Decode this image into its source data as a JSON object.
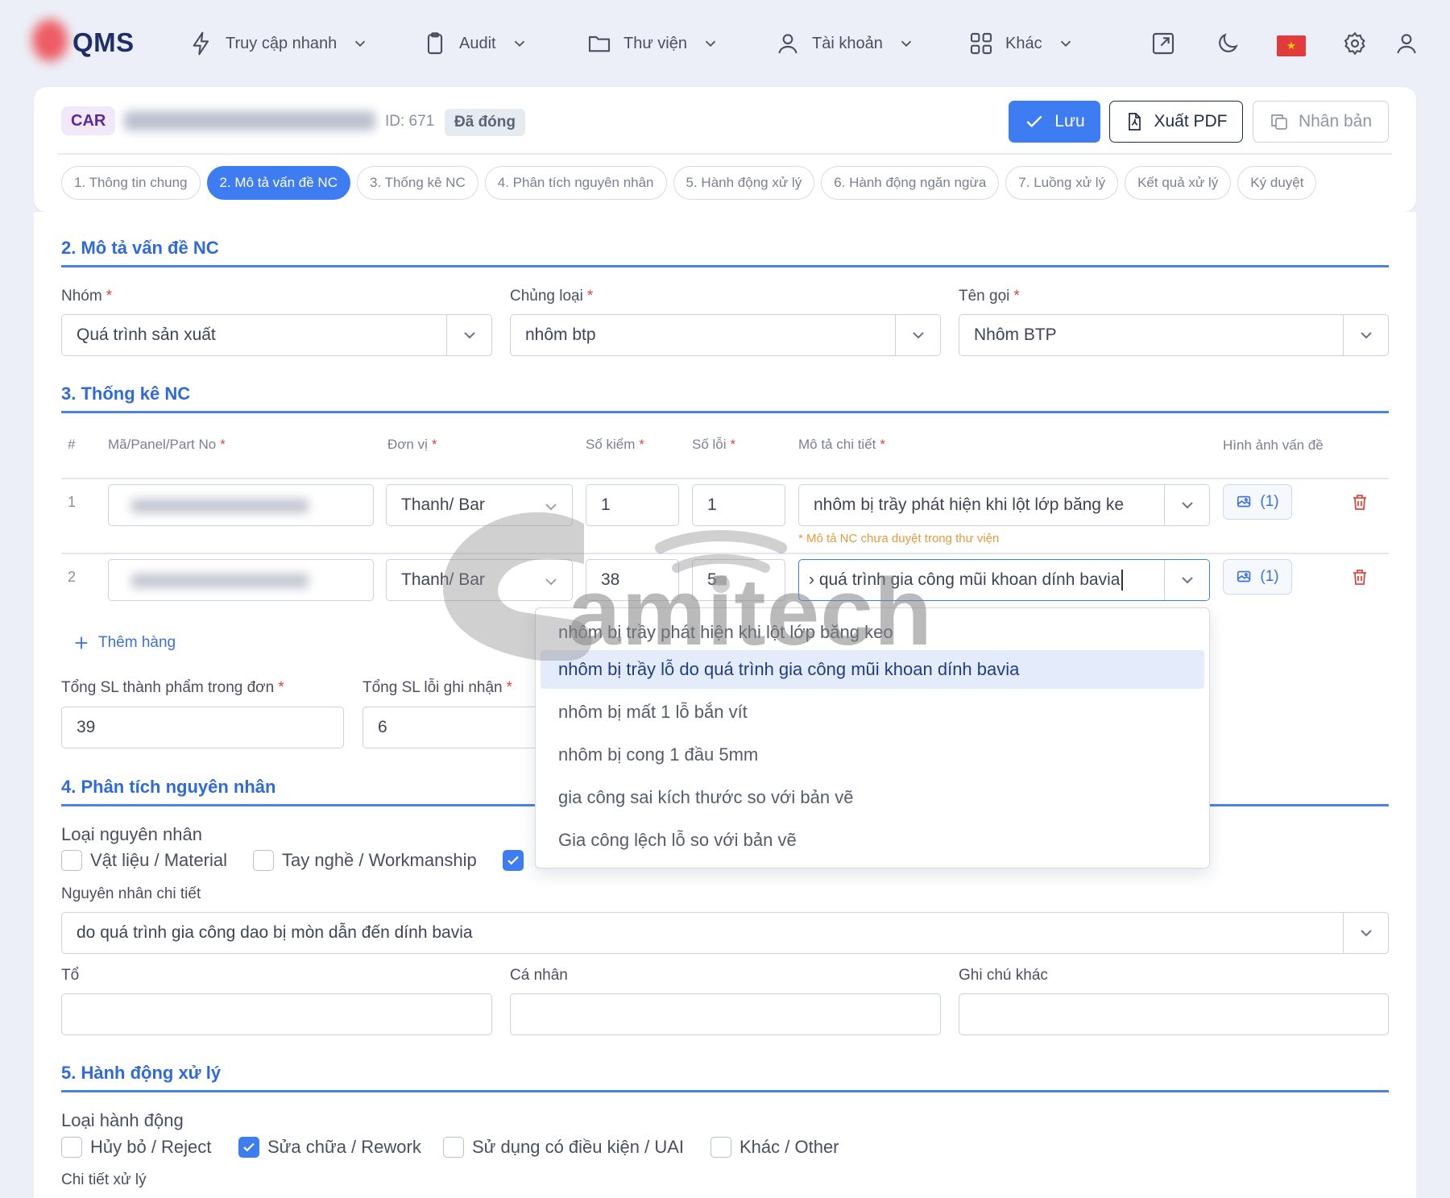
{
  "app": {
    "logo": "QMS"
  },
  "nav": [
    {
      "label": "Truy cập nhanh",
      "icon": "bolt-icon"
    },
    {
      "label": "Audit",
      "icon": "clipboard-icon"
    },
    {
      "label": "Thư viện",
      "icon": "folder-icon"
    },
    {
      "label": "Tài khoản",
      "icon": "user-icon"
    },
    {
      "label": "Khác",
      "icon": "grid-icon"
    }
  ],
  "header": {
    "type_badge": "CAR",
    "id_label": "ID: 671",
    "status": "Đã đóng",
    "save_label": "Lưu",
    "pdf_label": "Xuất PDF",
    "duplicate_label": "Nhân bản",
    "accent_color": "#3d7df1"
  },
  "tabs": [
    "1. Thông tin chung",
    "2. Mô tả vấn đề NC",
    "3. Thống kê NC",
    "4. Phân tích nguyên nhân",
    "5. Hành động xử lý",
    "6. Hành động ngăn ngừa",
    "7. Luồng xử lý",
    "Kết quả xử lý",
    "Ký duyệt"
  ],
  "section2": {
    "title": "2. Mô tả vấn đề NC",
    "group_label": "Nhóm",
    "group_value": "Quá trình sản xuất",
    "type_label": "Chủng loại",
    "type_value": "nhôm btp",
    "name_label": "Tên gọi",
    "name_value": "Nhôm BTP"
  },
  "section3": {
    "title": "3. Thống kê NC",
    "columns": [
      "#",
      "Mã/Panel/Part No",
      "Đơn vị",
      "Số kiểm",
      "Số lỗi",
      "Mô tả chi tiết",
      "Hình ảnh vấn đề"
    ],
    "rows": [
      {
        "num": "1",
        "unit": "Thanh/ Bar",
        "checked": "1",
        "defects": "1",
        "description": "nhôm bị trầy phát hiện khi lột lớp băng ke",
        "images": "(1)",
        "warning": "* Mô tả NC chưa duyệt trong thư viện"
      },
      {
        "num": "2",
        "unit": "Thanh/ Bar",
        "checked": "38",
        "defects": "5",
        "description": "› quá trình gia công mũi khoan dính bavia",
        "images": "(1)"
      }
    ],
    "add_row": "Thêm hàng",
    "total_products_label": "Tổng SL thành phẩm trong đơn",
    "total_products": "39",
    "total_defects_label": "Tổng SL lỗi ghi nhận",
    "total_defects": "6"
  },
  "dropdown": {
    "options": [
      "nhôm bị trầy phát hiện khi lột lớp băng keo",
      "nhôm bị trầy lỗ do quá trình gia công mũi khoan dính bavia",
      "nhôm bị mất 1 lỗ bắn vít",
      "nhôm bị cong 1 đầu 5mm",
      "gia công sai kích thước so với bản vẽ",
      "Gia công lệch lỗ so với bản vẽ"
    ],
    "selected_index": 1
  },
  "section4": {
    "title": "4. Phân tích nguyên nhân",
    "cause_type_label": "Loại nguyên nhân",
    "causes": [
      {
        "label": "Vật liệu / Material",
        "checked": false
      },
      {
        "label": "Tay nghề / Workmanship",
        "checked": false
      },
      {
        "label": "",
        "checked": true
      }
    ],
    "detail_label": "Nguyên nhân chi tiết",
    "detail_value": "do quá trình gia công dao bị mòn dẫn đến dính bavia",
    "team_label": "Tổ",
    "person_label": "Cá nhân",
    "note_label": "Ghi chú khác"
  },
  "section5": {
    "title": "5. Hành động xử lý",
    "action_type_label": "Loại hành động",
    "actions": [
      {
        "label": "Hủy bỏ / Reject",
        "checked": false
      },
      {
        "label": "Sửa chữa / Rework",
        "checked": true
      },
      {
        "label": "Sử dụng có điều kiện / UAI",
        "checked": false
      },
      {
        "label": "Khác / Other",
        "checked": false
      }
    ],
    "detail_label": "Chi tiết xử lý"
  },
  "watermark": "amitech"
}
